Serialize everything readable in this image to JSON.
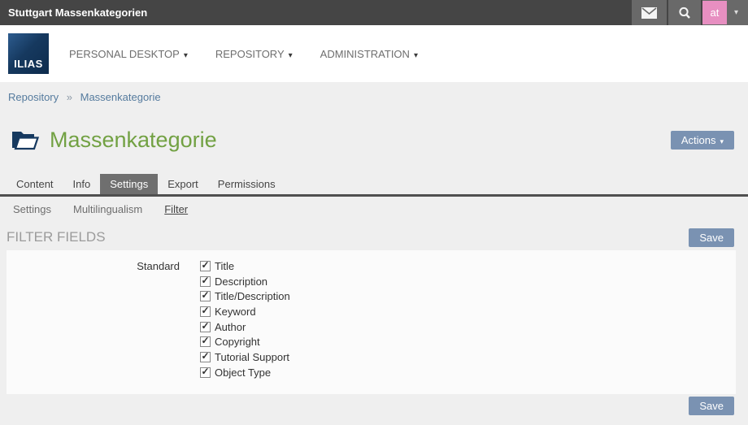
{
  "topbar": {
    "title": "Stuttgart Massenkategorien",
    "avatar_initials": "at",
    "caret": "▾"
  },
  "mainnav": {
    "logo_text": "ILIAS",
    "items": [
      {
        "label": "PERSONAL DESKTOP"
      },
      {
        "label": "REPOSITORY"
      },
      {
        "label": "ADMINISTRATION"
      }
    ],
    "caret": "▾"
  },
  "breadcrumb": {
    "separator": "»",
    "items": [
      {
        "label": "Repository"
      },
      {
        "label": "Massenkategorie"
      }
    ]
  },
  "page": {
    "title": "Massenkategorie",
    "actions_label": "Actions",
    "actions_caret": "▾"
  },
  "tabs": [
    {
      "label": "Content",
      "active": false
    },
    {
      "label": "Info",
      "active": false
    },
    {
      "label": "Settings",
      "active": true
    },
    {
      "label": "Export",
      "active": false
    },
    {
      "label": "Permissions",
      "active": false
    }
  ],
  "subtabs": [
    {
      "label": "Settings",
      "active": false
    },
    {
      "label": "Multilingualism",
      "active": false
    },
    {
      "label": "Filter",
      "active": true
    }
  ],
  "form": {
    "section_title": "FILTER FIELDS",
    "save_label": "Save",
    "field_label": "Standard",
    "checkboxes": [
      {
        "label": "Title",
        "checked": true
      },
      {
        "label": "Description",
        "checked": true
      },
      {
        "label": "Title/Description",
        "checked": true
      },
      {
        "label": "Keyword",
        "checked": true
      },
      {
        "label": "Author",
        "checked": true
      },
      {
        "label": "Copyright",
        "checked": true
      },
      {
        "label": "Tutorial Support",
        "checked": true
      },
      {
        "label": "Object Type",
        "checked": true
      }
    ]
  },
  "colors": {
    "topbar": "#454545",
    "topbar_button": "#696969",
    "avatar_pink": "#e78fc1",
    "logo_navy": "#0d2b4c",
    "link_blue": "#557b9e",
    "title_green": "#72a143",
    "button_blue": "#7a92b2",
    "active_tab_gray": "#6f6f6f",
    "content_bg": "#efefef",
    "panel_bg": "#fbfbfb"
  }
}
